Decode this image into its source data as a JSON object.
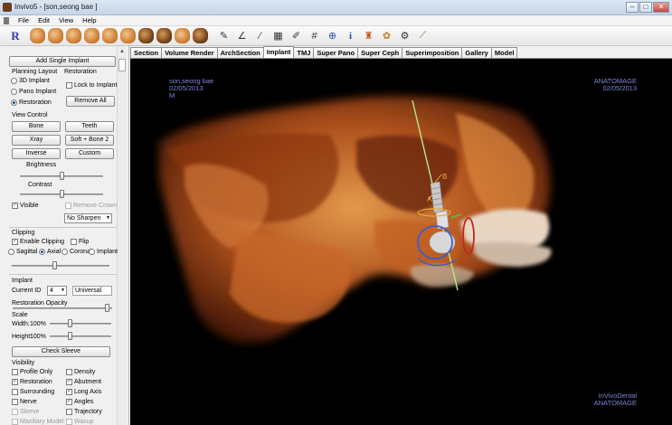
{
  "window": {
    "title": "Invivo5 - [son,seong bae ]",
    "controls": [
      "–",
      "□",
      "✕"
    ]
  },
  "menu": [
    "File",
    "Edit",
    "View",
    "Help"
  ],
  "toolbar": {
    "r_label": "R"
  },
  "tabs": [
    {
      "label": "Section",
      "active": false
    },
    {
      "label": "Volume Render",
      "active": false
    },
    {
      "label": "ArchSection",
      "active": false
    },
    {
      "label": "Implant",
      "active": true
    },
    {
      "label": "TMJ",
      "active": false
    },
    {
      "label": "Super Pano",
      "active": false
    },
    {
      "label": "Super Ceph",
      "active": false
    },
    {
      "label": "Superimposition",
      "active": false
    },
    {
      "label": "Gallery",
      "active": false
    },
    {
      "label": "Model",
      "active": false
    }
  ],
  "sidebar": {
    "add_single_implant": "Add Single Implant",
    "planning_layout": "Planning Layout",
    "restoration_header": "Restoration",
    "layout_3d": "3D Implant",
    "layout_pano": "Pano Implant",
    "layout_restoration": "Restoration",
    "lock_to_implant": "Lock to Implant",
    "remove_all": "Remove All",
    "view_control": "View Control",
    "btn_bone": "Bone",
    "btn_teeth": "Teeth",
    "btn_xray": "Xray",
    "btn_soft_bone": "Soft + Bone 2",
    "btn_inverse": "Inverse",
    "btn_custom": "Custom",
    "brightness": "Brightness",
    "contrast": "Contrast",
    "visible": "Visible",
    "remove_crown": "Remove Crown",
    "sharpen_value": "No Sharpen",
    "clipping": "Clipping",
    "enable_clipping": "Enable Clipping",
    "flip": "Flip",
    "clip_sagittal": "Sagittal",
    "clip_axial": "Axial",
    "clip_coronal": "Coronal",
    "clip_implant": "Implant",
    "implant_section": "Implant",
    "current_id_label": "Current ID",
    "current_id_value": "4",
    "universal": "Universal",
    "restoration_opacity": "Restoration Opacity",
    "scale": "Scale",
    "width_label": "Width:",
    "width_value": "100%",
    "height_label": "Height:",
    "height_value": "100%",
    "check_sleeve": "Check Sleeve",
    "visibility": "Visibility",
    "vis_profile_only": "Profile Only",
    "vis_density": "Density",
    "vis_restoration": "Restoration",
    "vis_abutment": "Abutment",
    "vis_surrounding": "Surrounding",
    "vis_long_axis": "Long Axis",
    "vis_nerve": "Nerve",
    "vis_angles": "Angles",
    "vis_sleeve": "Sleeve",
    "vis_trajectory": "Trajectory",
    "vis_maxillary": "Maxillary Model",
    "vis_waxup": "Waxup"
  },
  "viewport": {
    "patient_name": "son,seong bae",
    "date_left": "02/05/2013",
    "sex": "M",
    "brand_top": "ANATOMAGE",
    "date_right": "02/05/2013",
    "brand_bottom_1": "InVivoDental",
    "brand_bottom_2": "ANATOMAGE",
    "implant_label_a": "A",
    "implant_label_b": "B"
  },
  "colors": {
    "overlay_text": "#7d86d8",
    "bone_render": "#c8672a",
    "axis_line": "#b8e88a"
  }
}
